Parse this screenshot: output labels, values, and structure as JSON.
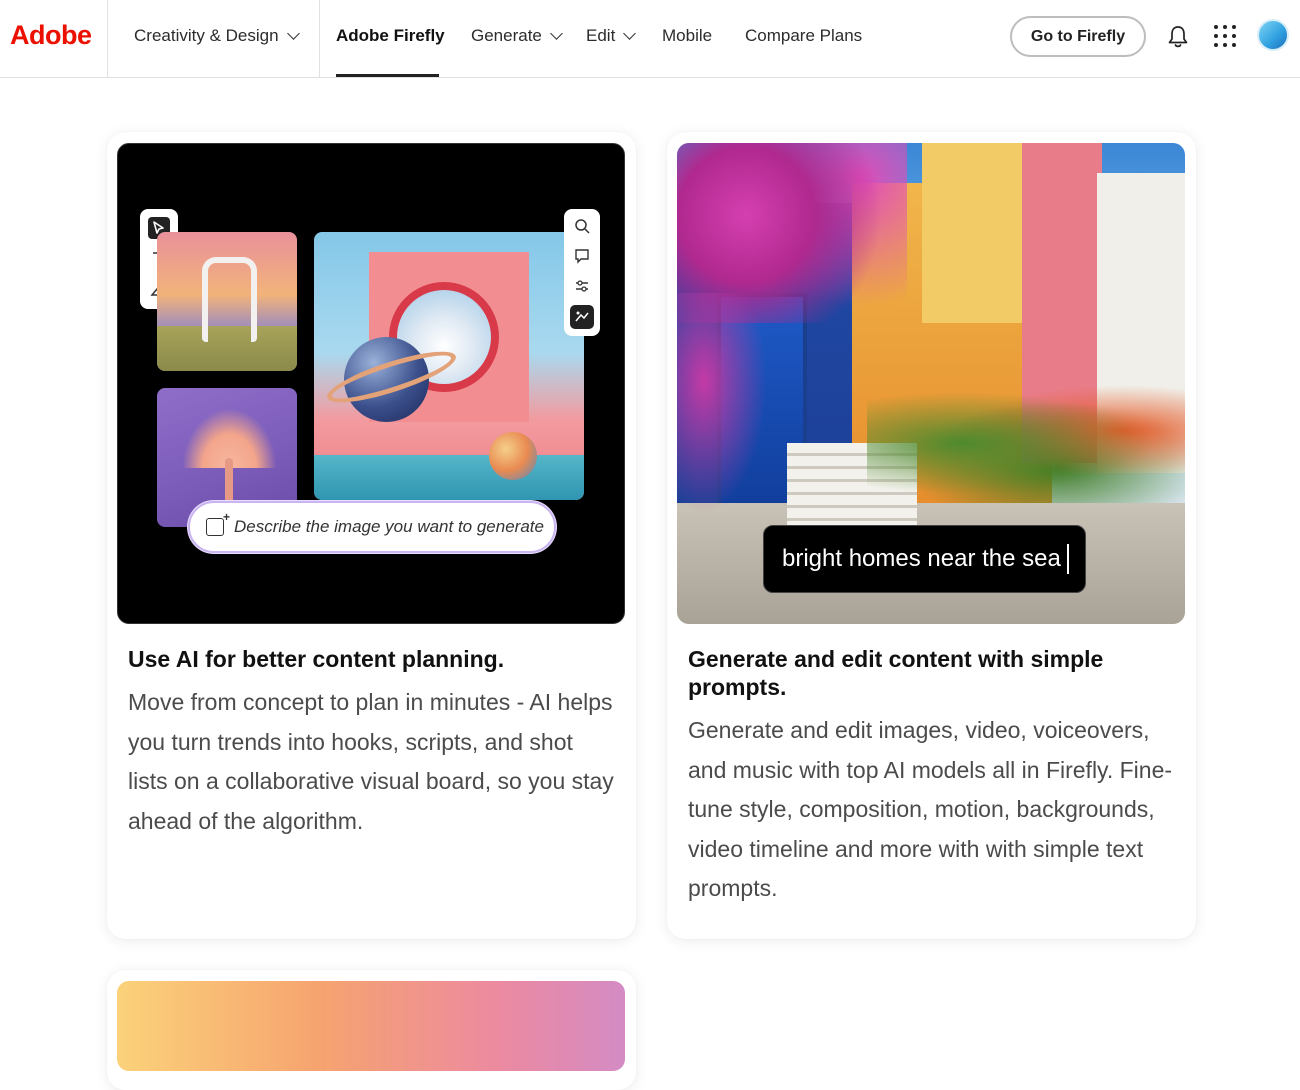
{
  "nav": {
    "logo": "Adobe",
    "items": [
      {
        "label": "Creativity & Design",
        "dropdown": true
      },
      {
        "label": "Adobe Firefly",
        "active": true
      },
      {
        "label": "Generate",
        "dropdown": true
      },
      {
        "label": "Edit",
        "dropdown": true
      },
      {
        "label": "Mobile"
      },
      {
        "label": "Compare Plans"
      }
    ],
    "cta": "Go to Firefly",
    "icons": [
      "bell-icon",
      "app-grid-icon",
      "avatar"
    ],
    "colors": {
      "brand": "#eb1000",
      "underline": "#222222"
    }
  },
  "cards": [
    {
      "title": "Use AI for better content planning.",
      "body": "Move from concept to plan in minutes - AI helps you turn trends into hooks, scripts, and shot lists on a collaborative visual board, so you stay ahead of the algorithm.",
      "media": {
        "prompt_placeholder": "Describe the image you want to generate",
        "left_tools": [
          "select-pointer-icon",
          "text-tool-icon",
          "image-gen-icon"
        ],
        "right_tools": [
          "zoom-icon",
          "comment-icon",
          "adjust-icon",
          "generate-icon"
        ]
      }
    },
    {
      "title": "Generate and edit content with simple prompts.",
      "body": "Generate and edit images, video, voiceovers, and music with top AI models all in Firefly. Fine-tune style, composition, motion, backgrounds, video timeline and more with with simple text prompts.",
      "media": {
        "caption": "bright homes near the sea"
      }
    }
  ]
}
